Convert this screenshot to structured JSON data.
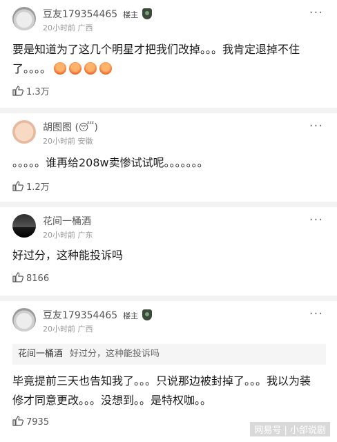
{
  "comments": [
    {
      "username": "豆友179354465",
      "badge": "楼主",
      "time": "20小时前",
      "location": "广西",
      "text": "要是知道为了这几个明星才把我们改掉。。。我肯定退掉不住了。。。。",
      "likes": "1.3万"
    },
    {
      "username": "胡图图",
      "time": "20小时前",
      "location": "安徽",
      "text": "。。。。。谁再给208w卖惨试试呢。。。。。。。",
      "likes": "1.2万"
    },
    {
      "username": "花间一桶酒",
      "time": "20小时前",
      "location": "广东",
      "text": "好过分，这种能投诉吗",
      "likes": "8166"
    },
    {
      "username": "豆友179354465",
      "badge": "楼主",
      "time": "20小时前",
      "location": "广西",
      "quote_name": "花间一桶酒",
      "quote_text": "好过分，这种能投诉吗",
      "text": "毕竟提前三天也告知我了。。。只说那边被封掉了。。。我以为装修才同意更改。。。没想到。。是特权咖。。",
      "likes": "7935"
    }
  ],
  "more_icon": "···",
  "watermark": "网易号 | 小郃说剧",
  "colors": {
    "divider": "#f2f2f2",
    "quote_bg": "#f5f5f5"
  }
}
